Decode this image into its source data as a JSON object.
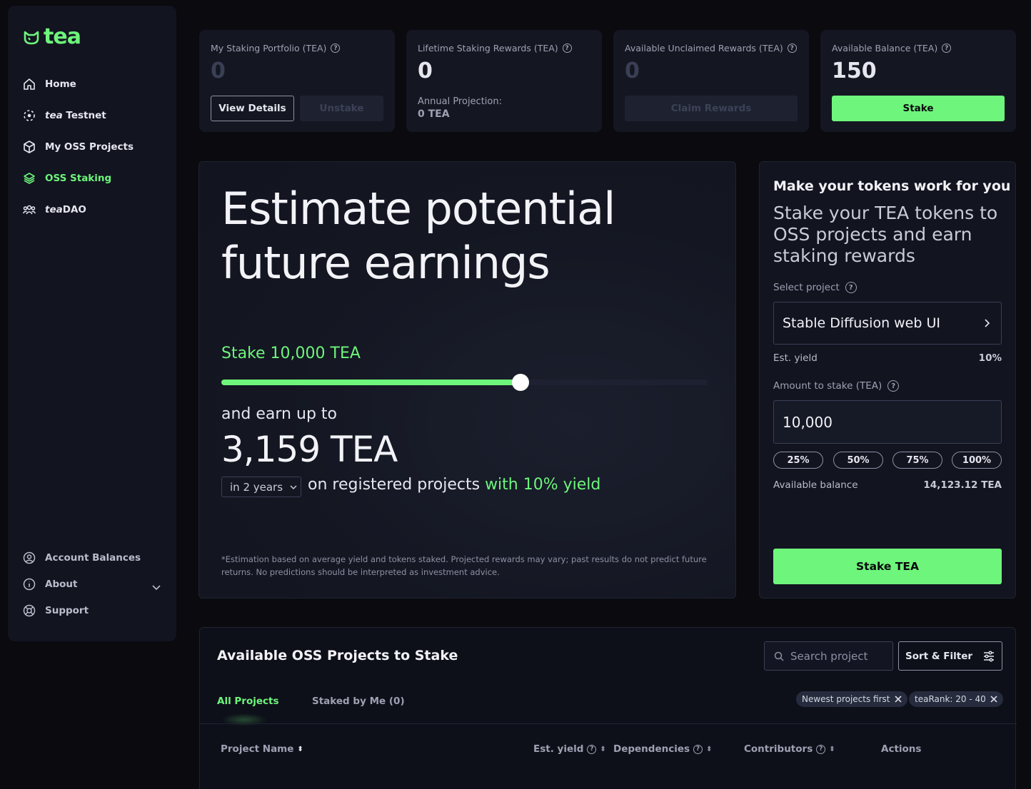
{
  "brand": {
    "name": "tea",
    "accent": "#6ef57b"
  },
  "sidebar": {
    "items": [
      {
        "label": "Home",
        "icon": "home-icon"
      },
      {
        "label_prefix": "tea",
        "label": " Testnet",
        "icon": "testnet-icon"
      },
      {
        "label": "My OSS Projects",
        "icon": "package-icon"
      },
      {
        "label": "OSS Staking",
        "icon": "layers-icon",
        "active": true
      },
      {
        "label_prefix": "tea",
        "label": "DAO",
        "icon": "people-icon"
      }
    ],
    "bottom": [
      {
        "label": "Account Balances",
        "icon": "user-circle-icon"
      },
      {
        "label": "About",
        "icon": "info-icon"
      },
      {
        "label": "Support",
        "icon": "lifebuoy-icon"
      }
    ]
  },
  "cards": [
    {
      "title": "My Staking Portfolio (TEA)",
      "value": "0",
      "primary": "View Details",
      "secondary": "Unstake"
    },
    {
      "title": "Lifetime Staking Rewards (TEA)",
      "value": "0",
      "projection_label": "Annual Projection:",
      "projection_value": "0 TEA"
    },
    {
      "title": "Available Unclaimed Rewards (TEA)",
      "value": "0",
      "button": "Claim Rewards"
    },
    {
      "title": "Available Balance (TEA)",
      "value": "150",
      "button": "Stake"
    }
  ],
  "estimate": {
    "heading_line1": "Estimate potential",
    "heading_line2": "future earnings",
    "stake_label": "Stake 10,000 TEA",
    "slider_fraction": 0.615,
    "earn_label": "and earn up to",
    "earn_value": "3,159 TEA",
    "period": "in 2 years",
    "registered_text": "on registered projects ",
    "yield_text": "with 10% yield",
    "disclaimer": "*Estimation based on average yield and tokens staked. Projected rewards may vary; past results do not predict future returns. No predictions should be interpreted as investment advice."
  },
  "stake_panel": {
    "title": "Make your tokens work for you",
    "subtitle": "Stake your TEA tokens to OSS projects and earn staking rewards",
    "select_label": "Select project",
    "selected_project": "Stable Diffusion web UI",
    "est_yield_label": "Est. yield",
    "est_yield_value": "10%",
    "amount_label": "Amount to stake (TEA)",
    "amount_value": "10,000",
    "percents": [
      "25%",
      "50%",
      "75%",
      "100%"
    ],
    "balance_label": "Available balance",
    "balance_value": "14,123.12 TEA",
    "submit": "Stake TEA"
  },
  "projects": {
    "title": "Available OSS Projects to Stake",
    "search_placeholder": "Search project",
    "sort_label": "Sort & Filter",
    "tabs": [
      "All Projects",
      "Staked by Me (0)"
    ],
    "chips": [
      "Newest projects first",
      "teaRank: 20 - 40"
    ],
    "columns": [
      "Project Name",
      "Est. yield",
      "Dependencies",
      "Contributors",
      "Actions"
    ]
  }
}
